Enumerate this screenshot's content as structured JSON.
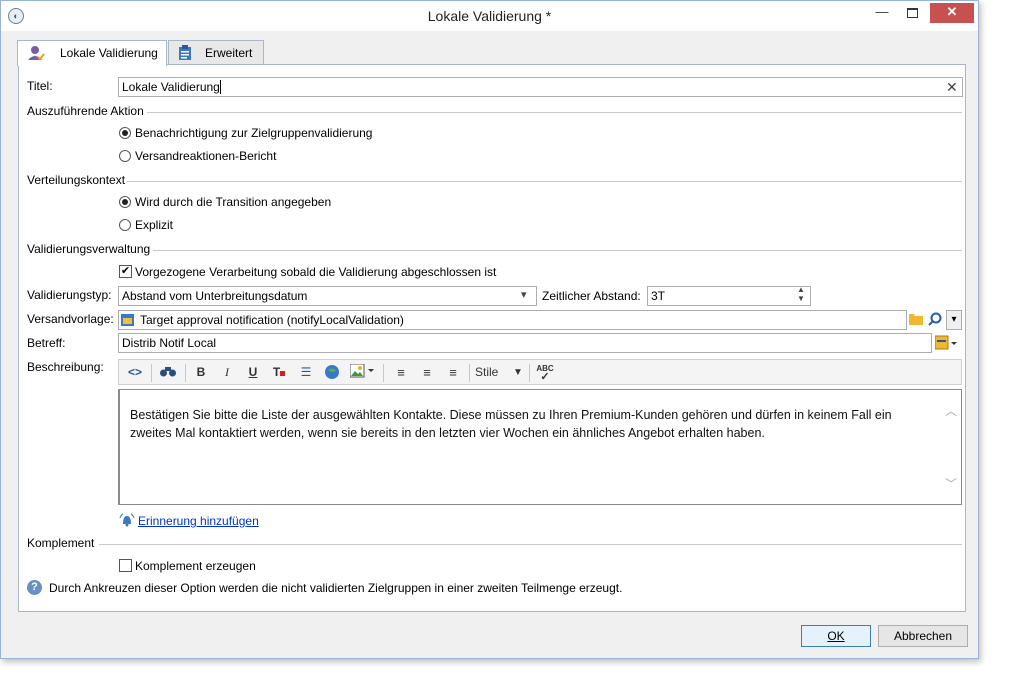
{
  "window": {
    "title": "Lokale Validierung *",
    "minimize": "—",
    "close": "✕"
  },
  "tabs": [
    {
      "label": "Lokale Validierung"
    },
    {
      "label": "Erweitert"
    }
  ],
  "fields": {
    "titel_label": "Titel:",
    "titel_value": "Lokale Validierung",
    "aktion_section": "Auszuführende Aktion",
    "aktion_options": [
      "Benachrichtigung zur Zielgruppenvalidierung",
      "Versandreaktionen-Bericht"
    ],
    "kontext_section": "Verteilungskontext",
    "kontext_options": [
      "Wird durch die Transition angegeben",
      "Explizit"
    ],
    "verwaltung_section": "Validierungsverwaltung",
    "vorgezogen_label": "Vorgezogene Verarbeitung sobald die Validierung abgeschlossen ist",
    "typ_label": "Validierungstyp:",
    "typ_value": "Abstand vom Unterbreitungsdatum",
    "abstand_label": "Zeitlicher Abstand:",
    "abstand_value": "3T",
    "vorlage_label": "Versandvorlage:",
    "vorlage_value": "Target approval notification (notifyLocalValidation)",
    "betreff_label": "Betreff:",
    "betreff_value": "Distrib Notif Local",
    "beschreibung_label": "Beschreibung:",
    "stile_label": "Stile",
    "editor_text": "Bestätigen Sie bitte die Liste der ausgewählten Kontakte. Diese müssen zu Ihren Premium-Kunden gehören und dürfen in keinem Fall ein zweites Mal kontaktiert werden, wenn sie bereits in den letzten vier Wochen ein ähnliches Angebot erhalten haben.",
    "reminder_link": "Erinnerung hinzufügen",
    "komplement_section": "Komplement",
    "komplement_check": "Komplement erzeugen",
    "hint_text": "Durch Ankreuzen dieser Option werden die nicht validierten Zielgruppen in einer zweiten Teilmenge erzeugt."
  },
  "buttons": {
    "ok": "OK",
    "cancel": "Abbrechen"
  },
  "colors": {
    "close_button": "#c75050",
    "link": "#0033cc",
    "tab_border": "#aab7c8"
  }
}
